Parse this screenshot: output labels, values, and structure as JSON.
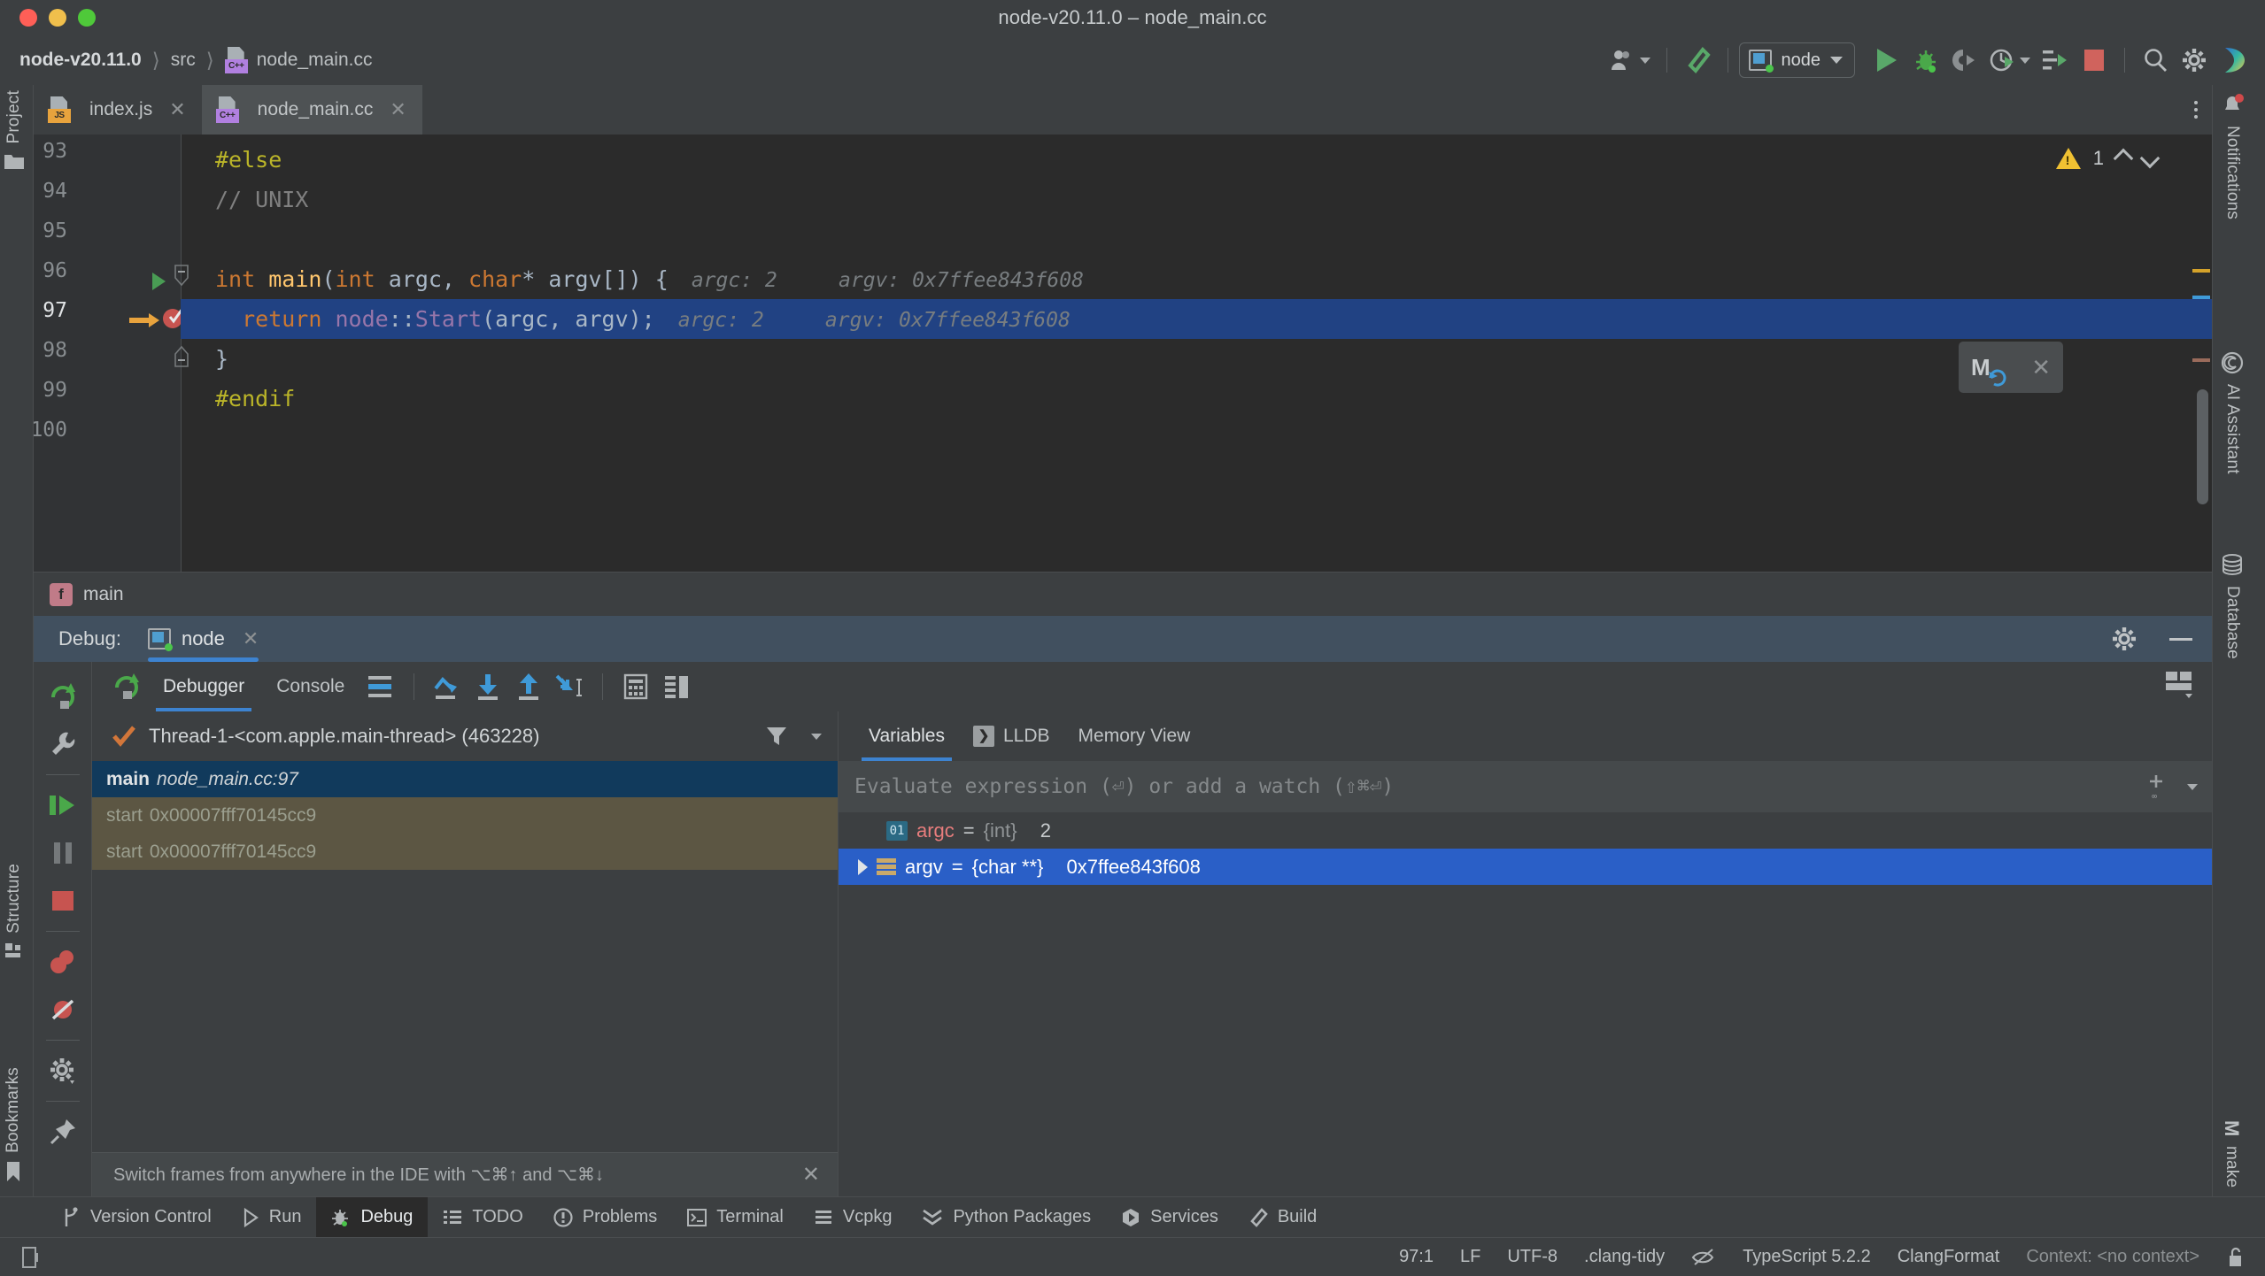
{
  "window": {
    "title": "node-v20.11.0 – node_main.cc"
  },
  "breadcrumb": {
    "project": "node-v20.11.0",
    "folder": "src",
    "file": "node_main.cc"
  },
  "toolbar": {
    "account_icon": "user-account-icon",
    "build_icon": "build-hammer-icon",
    "run_config": "node",
    "run_icon": "run-icon",
    "debug_icon": "debug-icon",
    "coverage_icon": "run-with-coverage-icon",
    "profiler_icon": "profiler-icon",
    "attach_icon": "attach-profiler-icon",
    "stop_icon": "stop-icon",
    "search_icon": "search-everywhere-icon",
    "settings_icon": "settings-gear-icon",
    "ai_icon": "ai-assistant-icon"
  },
  "editor_tabs": [
    {
      "label": "index.js",
      "badge": "JS",
      "active": false
    },
    {
      "label": "node_main.cc",
      "badge": "C++",
      "active": true
    }
  ],
  "editor": {
    "warning_count": "1",
    "floating_marker": "M",
    "lines": [
      {
        "num": "93",
        "tokens": [
          {
            "t": "#else",
            "c": "tok-pre"
          }
        ]
      },
      {
        "num": "94",
        "tokens": [
          {
            "t": "// UNIX",
            "c": "tok-cmt"
          }
        ]
      },
      {
        "num": "95",
        "tokens": []
      },
      {
        "num": "96",
        "tokens": [
          {
            "t": "int ",
            "c": "tok-kw"
          },
          {
            "t": "main",
            "c": "tok-fn"
          },
          {
            "t": "(",
            "c": "tok-pl"
          },
          {
            "t": "int ",
            "c": "tok-kw"
          },
          {
            "t": "argc, ",
            "c": "tok-pl"
          },
          {
            "t": "char",
            "c": "tok-kw"
          },
          {
            "t": "* argv[]) {",
            "c": "tok-pl"
          }
        ],
        "inlay": "argc: 2     argv: 0x7ffee843f608"
      },
      {
        "num": "97",
        "tokens": [
          {
            "t": "  return ",
            "c": "tok-kw"
          },
          {
            "t": "node",
            "c": "tok-ns"
          },
          {
            "t": "::",
            "c": "tok-pl"
          },
          {
            "t": "Start",
            "c": "tok-ns"
          },
          {
            "t": "(argc, argv);",
            "c": "tok-pl"
          }
        ],
        "inlay": "argc: 2     argv: 0x7ffee843f608"
      },
      {
        "num": "98",
        "tokens": [
          {
            "t": "}",
            "c": "tok-pl"
          }
        ]
      },
      {
        "num": "99",
        "tokens": [
          {
            "t": "#endif",
            "c": "tok-pre"
          }
        ]
      },
      {
        "num": "100",
        "tokens": []
      }
    ]
  },
  "main_frame_bar": {
    "badge": "f",
    "label": "main"
  },
  "debug_header": {
    "label": "Debug:",
    "tab": "node",
    "settings_icon": "settings-gear-icon",
    "minimize_icon": "minimize-icon"
  },
  "debug_sidebar": [
    {
      "name": "rerun-button",
      "icon": "rerun-icon"
    },
    {
      "name": "edit-configuration-button",
      "icon": "wrench-icon"
    },
    {
      "name": "resume-program-button",
      "icon": "resume-icon"
    },
    {
      "name": "pause-program-button",
      "icon": "pause-icon"
    },
    {
      "name": "stop-button",
      "icon": "stop-icon"
    },
    {
      "name": "view-breakpoints-button",
      "icon": "breakpoints-icon"
    },
    {
      "name": "mute-breakpoints-button",
      "icon": "mute-breakpoints-icon"
    },
    {
      "name": "settings-button",
      "icon": "settings-gear-icon"
    },
    {
      "name": "pin-tab-button",
      "icon": "pin-icon"
    }
  ],
  "debug_toolbar": {
    "restart_icon": "restart-icon",
    "tabs": [
      {
        "label": "Debugger",
        "active": true
      },
      {
        "label": "Console",
        "active": false
      }
    ],
    "buttons": [
      {
        "name": "show-execution-point-button",
        "icon": "execution-point-icon"
      },
      {
        "name": "step-over-button",
        "icon": "step-over-icon"
      },
      {
        "name": "step-into-button",
        "icon": "step-into-icon"
      },
      {
        "name": "step-out-button",
        "icon": "step-out-icon"
      },
      {
        "name": "run-to-cursor-button",
        "icon": "run-to-cursor-icon"
      },
      {
        "name": "evaluate-expression-button",
        "icon": "calculator-icon"
      },
      {
        "name": "layout-settings-button",
        "icon": "layout-icon"
      }
    ],
    "layout_icon": "layout-settings-icon"
  },
  "frames": {
    "thread": "Thread-1-<com.apple.main-thread> (463228)",
    "thread_check_icon": "check-icon",
    "filter_icon": "filter-icon",
    "dropdown_icon": "chevron-down-icon",
    "rows": [
      {
        "name": "main",
        "loc": "node_main.cc:97",
        "kind": "selected"
      },
      {
        "name": "start",
        "loc": "0x00007fff70145cc9",
        "kind": "library"
      },
      {
        "name": "start",
        "loc": "0x00007fff70145cc9",
        "kind": "library"
      }
    ],
    "hint": "Switch frames from anywhere in the IDE with ⌥⌘↑ and ⌥⌘↓",
    "hint_close_icon": "close-icon"
  },
  "variables": {
    "tabs": [
      {
        "label": "Variables",
        "active": true
      },
      {
        "label": "LLDB",
        "active": false,
        "icon": "lldb-console-icon"
      },
      {
        "label": "Memory View",
        "active": false
      }
    ],
    "evaluate_placeholder": "Evaluate expression (⏎) or add a watch (⇧⌘⏎)",
    "add_watch_icon": "add-watch-icon",
    "dropdown_icon": "chevron-down-icon",
    "rows": [
      {
        "icon": "int-type-icon",
        "name": "argc",
        "eq": " = ",
        "type": "{int}",
        "value": "2",
        "selected": false,
        "expandable": false
      },
      {
        "icon": "array-type-icon",
        "name": "argv",
        "eq": " = ",
        "type": "{char **}",
        "value": "0x7ffee843f608",
        "selected": true,
        "expandable": true
      }
    ]
  },
  "left_stripe": [
    {
      "label": "Project",
      "icon": "folder-icon"
    },
    {
      "label": "Structure",
      "icon": "structure-icon"
    },
    {
      "label": "Bookmarks",
      "icon": "bookmark-icon"
    }
  ],
  "right_stripe": [
    {
      "label": "Notifications",
      "icon": "notification-bell-icon"
    },
    {
      "label": "AI Assistant",
      "icon": "ai-assistant-icon"
    },
    {
      "label": "Database",
      "icon": "database-icon"
    },
    {
      "label": "make",
      "icon": "make-icon"
    }
  ],
  "tool_windows": [
    {
      "label": "Version Control",
      "icon": "version-control-icon",
      "active": false
    },
    {
      "label": "Run",
      "icon": "run-icon",
      "active": false
    },
    {
      "label": "Debug",
      "icon": "debug-bug-icon",
      "active": true
    },
    {
      "label": "TODO",
      "icon": "todo-list-icon",
      "active": false
    },
    {
      "label": "Problems",
      "icon": "problems-icon",
      "active": false
    },
    {
      "label": "Terminal",
      "icon": "terminal-icon",
      "active": false
    },
    {
      "label": "Vcpkg",
      "icon": "vcpkg-icon",
      "active": false
    },
    {
      "label": "Python Packages",
      "icon": "python-packages-icon",
      "active": false
    },
    {
      "label": "Services",
      "icon": "services-icon",
      "active": false
    },
    {
      "label": "Build",
      "icon": "build-hammer-icon",
      "active": false
    }
  ],
  "status_bar": {
    "memory_icon": "memory-indicator-icon",
    "caret": "97:1",
    "line_sep": "LF",
    "encoding": "UTF-8",
    "inspection": ".clang-tidy",
    "inspection_icon": "inspections-eye-icon",
    "language": "TypeScript 5.2.2",
    "formatter": "ClangFormat",
    "context": "Context: <no context>",
    "lock_icon": "read-write-lock-icon"
  },
  "colors": {
    "accent_blue": "#3d83d0",
    "selection_blue": "#2a5fc7",
    "editor_bg": "#2b2b2b",
    "panel_bg": "#3c3f41",
    "warning_yellow": "#f0c132",
    "run_green": "#59a869",
    "stop_red": "#d0635d"
  }
}
